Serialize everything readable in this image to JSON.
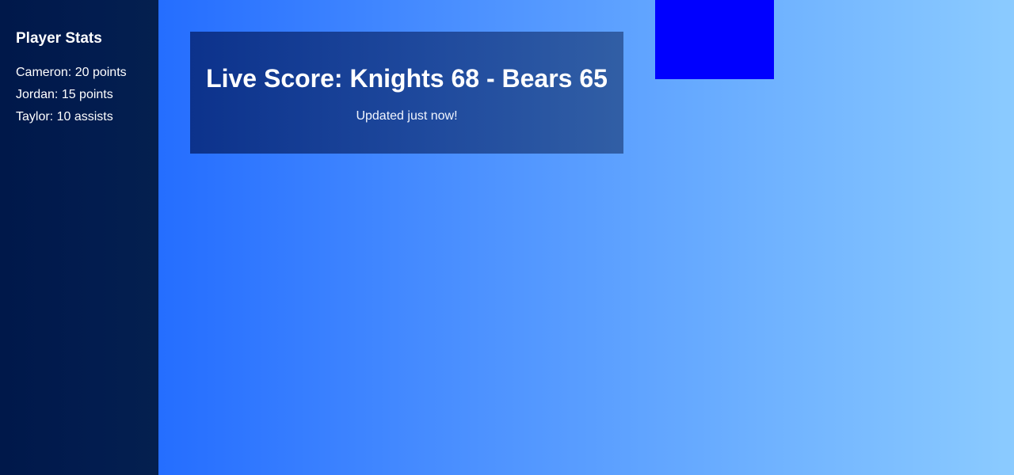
{
  "sidebar": {
    "title": "Player Stats",
    "items": [
      {
        "label": "Cameron: 20 points"
      },
      {
        "label": "Jordan: 15 points"
      },
      {
        "label": "Taylor: 10 assists"
      }
    ]
  },
  "scoreboard": {
    "title": "Live Score: Knights 68 - Bears 65",
    "updated": "Updated just now!"
  },
  "colors": {
    "sidebar_bg": "#001a4d",
    "main_gradient_start": "#1160ff",
    "main_gradient_end": "#8bcbff",
    "card_bg": "#0f347f",
    "block_color": "#0000ff"
  }
}
